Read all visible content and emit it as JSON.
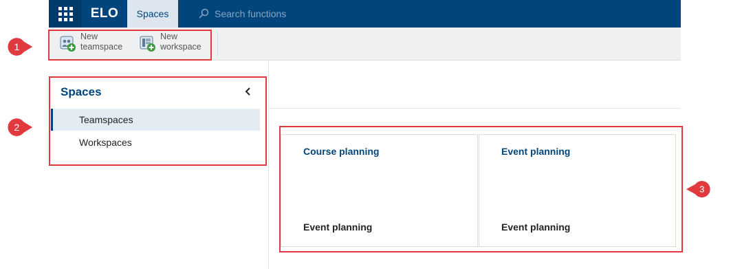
{
  "topbar": {
    "logo": "ELO",
    "active_tab": "Spaces",
    "search_placeholder": "Search functions"
  },
  "ribbon": {
    "buttons": [
      {
        "line1": "New",
        "line2": "teamspace",
        "icon": "new-teamspace-icon"
      },
      {
        "line1": "New",
        "line2": "workspace",
        "icon": "new-workspace-icon"
      }
    ]
  },
  "sidebar": {
    "title": "Spaces",
    "items": [
      {
        "label": "Teamspaces",
        "active": true
      },
      {
        "label": "Workspaces",
        "active": false
      }
    ]
  },
  "cards": [
    {
      "title": "Course planning",
      "footer": "Event planning"
    },
    {
      "title": "Event planning",
      "footer": "Event planning"
    }
  ],
  "annotations": [
    "1",
    "2",
    "3"
  ],
  "colors": {
    "brand": "#00457c",
    "annotation": "#e0393e"
  }
}
